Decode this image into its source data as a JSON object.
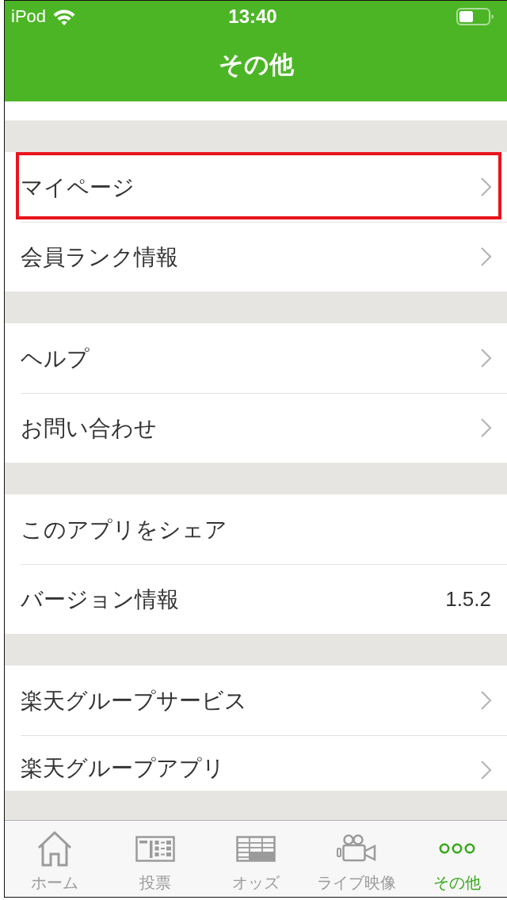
{
  "status_bar": {
    "carrier": "iPod",
    "time": "13:40"
  },
  "nav_bar": {
    "title": "その他"
  },
  "sections": [
    {
      "items": [
        {
          "kind": "link",
          "label": "マイページ",
          "highlighted": true
        },
        {
          "kind": "link",
          "label": "会員ランク情報",
          "highlighted": false
        }
      ]
    },
    {
      "items": [
        {
          "kind": "link",
          "label": "ヘルプ",
          "highlighted": false
        },
        {
          "kind": "link",
          "label": "お問い合わせ",
          "highlighted": false
        }
      ]
    },
    {
      "items": [
        {
          "kind": "plain",
          "label": "このアプリをシェア",
          "highlighted": false
        },
        {
          "kind": "value",
          "label": "バージョン情報",
          "value": "1.5.2",
          "highlighted": false
        }
      ]
    },
    {
      "items": [
        {
          "kind": "link",
          "label": "楽天グループサービス",
          "highlighted": false
        },
        {
          "kind": "link",
          "label": "楽天グループアプリ",
          "highlighted": false
        }
      ]
    }
  ],
  "tab_bar": {
    "tabs": [
      {
        "kind": "home",
        "label": "ホーム",
        "selected": false
      },
      {
        "kind": "ticket",
        "label": "投票",
        "selected": false
      },
      {
        "kind": "table",
        "label": "オッズ",
        "selected": false
      },
      {
        "kind": "camera",
        "label": "ライブ映像",
        "selected": false
      },
      {
        "kind": "more",
        "label": "その他",
        "selected": true
      }
    ]
  }
}
